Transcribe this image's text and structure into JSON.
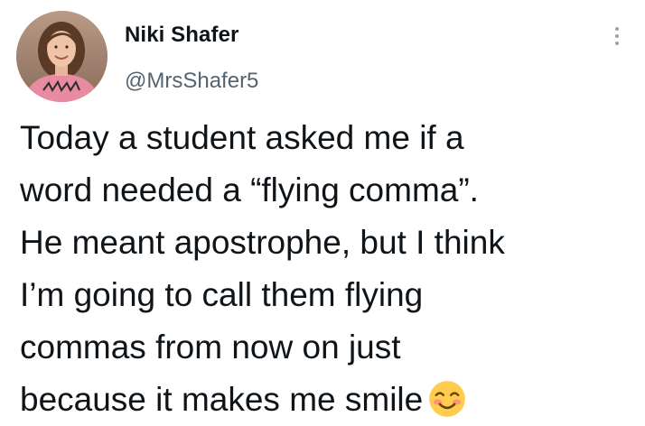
{
  "author": {
    "name": "Niki Shafer",
    "handle": "@MrsShafer5"
  },
  "tweet": {
    "lines": [
      "Today a student asked me if a",
      "word needed a “flying comma”.",
      "He meant apostrophe, but I think",
      "I’m going to call them flying",
      "commas from now on just",
      "because it makes me smile"
    ],
    "emoji": "smiling-face-with-smiling-eyes"
  },
  "icons": {
    "more": "more-options-icon"
  }
}
